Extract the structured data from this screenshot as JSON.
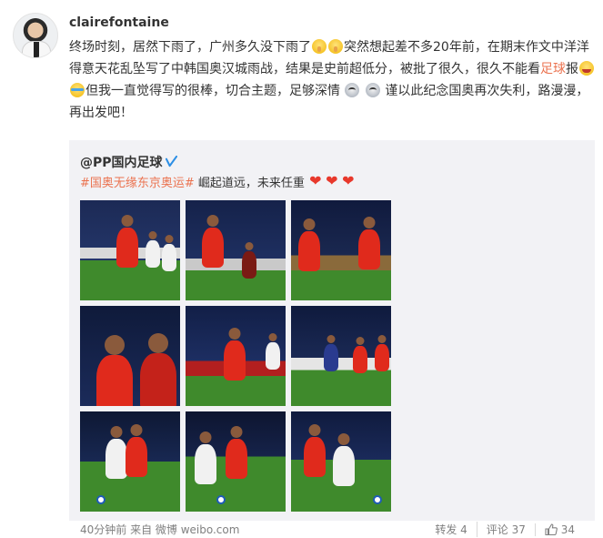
{
  "post": {
    "username": "clairefontaine",
    "text_1": "终场时刻，居然下雨了，广州多久没下雨了",
    "text_2": "突然想起差不多20年前，在期末作文中洋洋得意天花乱坠写了中韩国奥汉城雨战，结果是史前超低分，被批了很久，很久不能看",
    "text_highlight": "足球",
    "text_3": "报",
    "text_4": "但我一直觉得写的很棒，切合主题，足够深情",
    "text_5": "谨以此纪念国奥再次失利，路漫漫，再出发吧！"
  },
  "repost": {
    "author": "@PP国内足球",
    "hashtag": "#国奥无缘东京奥运#",
    "text": " 崛起道远，未来任重"
  },
  "footer": {
    "time_source": "40分钟前 来自 微博 weibo.com",
    "repost_label": "转发 4",
    "comment_label": "评论 37",
    "like_count": "34"
  },
  "colors": {
    "highlight": "#eb7350",
    "jersey_red": "#e02a1c",
    "verified_blue": "#2d8fe5"
  },
  "icons": [
    "verified-icon",
    "hush-emoji",
    "laugh-emoji",
    "cry-emoji",
    "sad-emoji",
    "heart-emoji",
    "like-icon"
  ]
}
